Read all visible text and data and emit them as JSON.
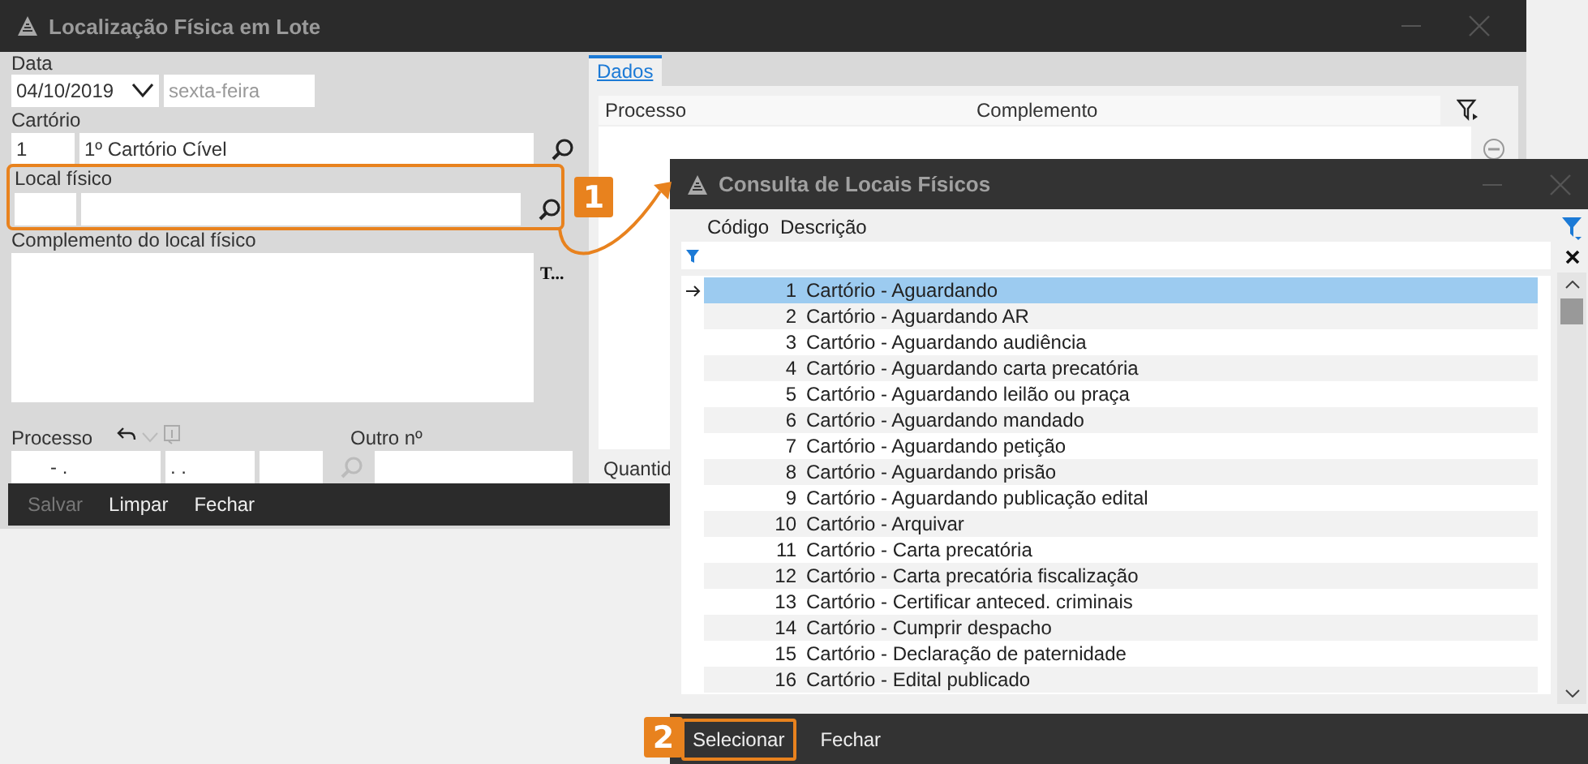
{
  "main_window": {
    "title": "Localização Física em Lote",
    "date": {
      "label": "Data",
      "value": "04/10/2019",
      "weekday": "sexta-feira"
    },
    "cartorio": {
      "label": "Cartório",
      "code": "1",
      "name": "1º Cartório Cível"
    },
    "local_fisico": {
      "label": "Local físico",
      "highlighted": true
    },
    "complemento": {
      "label": "Complemento do local físico",
      "button": "T..."
    },
    "processo": {
      "label": "Processo",
      "part_1": "- .",
      "part_2": ". .",
      "other_label": "Outro nº"
    },
    "tabs": [
      {
        "label": "Dados",
        "selected": true
      }
    ],
    "grid": {
      "columns": [
        "Processo",
        "Complemento"
      ],
      "footer": "Quantid"
    },
    "buttons": [
      {
        "label": "Salvar",
        "disabled": true
      },
      {
        "label": "Limpar",
        "disabled": false
      },
      {
        "label": "Fechar",
        "disabled": false
      }
    ]
  },
  "dialog": {
    "title": "Consulta de Locais Físicos",
    "columns": [
      "Código",
      "Descrição"
    ],
    "rows": [
      {
        "code": "1",
        "description": "Cartório - Aguardando",
        "selected": true
      },
      {
        "code": "2",
        "description": "Cartório - Aguardando AR",
        "selected": false
      },
      {
        "code": "3",
        "description": "Cartório - Aguardando audiência",
        "selected": false
      },
      {
        "code": "4",
        "description": "Cartório - Aguardando carta precatória",
        "selected": false
      },
      {
        "code": "5",
        "description": "Cartório - Aguardando leilão ou praça",
        "selected": false
      },
      {
        "code": "6",
        "description": "Cartório - Aguardando mandado",
        "selected": false
      },
      {
        "code": "7",
        "description": "Cartório - Aguardando petição",
        "selected": false
      },
      {
        "code": "8",
        "description": "Cartório - Aguardando prisão",
        "selected": false
      },
      {
        "code": "9",
        "description": "Cartório - Aguardando publicação edital",
        "selected": false
      },
      {
        "code": "10",
        "description": "Cartório - Arquivar",
        "selected": false
      },
      {
        "code": "11",
        "description": "Cartório - Carta precatória",
        "selected": false
      },
      {
        "code": "12",
        "description": "Cartório - Carta precatória fiscalização",
        "selected": false
      },
      {
        "code": "13",
        "description": "Cartório - Certificar anteced. criminais",
        "selected": false
      },
      {
        "code": "14",
        "description": "Cartório - Cumprir despacho",
        "selected": false
      },
      {
        "code": "15",
        "description": "Cartório - Declaração de paternidade",
        "selected": false
      },
      {
        "code": "16",
        "description": "Cartório - Edital publicado",
        "selected": false
      }
    ],
    "buttons": [
      {
        "label": "Selecionar",
        "highlighted": true
      },
      {
        "label": "Fechar",
        "highlighted": false
      }
    ]
  },
  "callouts": [
    {
      "number": "1"
    },
    {
      "number": "2"
    }
  ]
}
